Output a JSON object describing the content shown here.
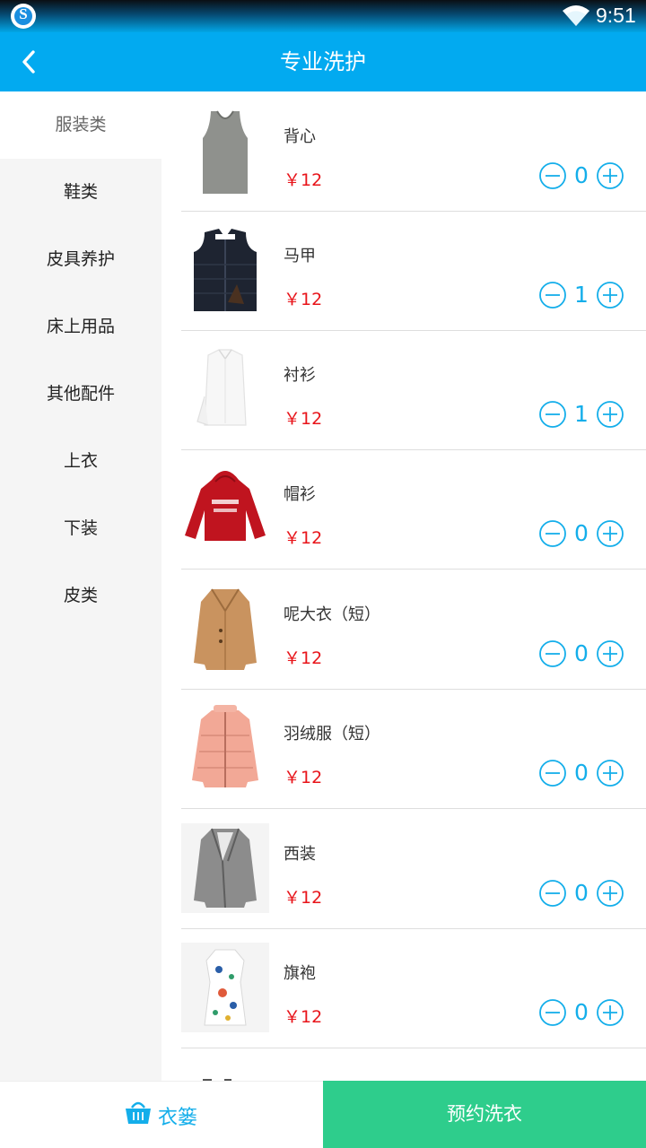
{
  "status_bar": {
    "time": "9:51",
    "app_icon": "sogou-s-icon",
    "wifi_icon": "wifi-icon"
  },
  "header": {
    "title": "专业洗护",
    "back_icon": "chevron-left-icon"
  },
  "categories": [
    {
      "label": "服装类",
      "active": true
    },
    {
      "label": "鞋类"
    },
    {
      "label": "皮具养护"
    },
    {
      "label": "床上用品"
    },
    {
      "label": "其他配件"
    },
    {
      "label": "上衣"
    },
    {
      "label": "下装"
    },
    {
      "label": "皮类"
    }
  ],
  "products": [
    {
      "name": "背心",
      "price": "￥12",
      "qty": "0",
      "image": "tank-top"
    },
    {
      "name": "马甲",
      "price": "￥12",
      "qty": "1",
      "image": "vest"
    },
    {
      "name": "衬衫",
      "price": "￥12",
      "qty": "1",
      "image": "shirt"
    },
    {
      "name": "帽衫",
      "price": "￥12",
      "qty": "0",
      "image": "hoodie"
    },
    {
      "name": "呢大衣（短）",
      "price": "￥12",
      "qty": "0",
      "image": "wool-coat"
    },
    {
      "name": "羽绒服（短）",
      "price": "￥12",
      "qty": "0",
      "image": "down-jacket"
    },
    {
      "name": "西装",
      "price": "￥12",
      "qty": "0",
      "image": "suit-jacket"
    },
    {
      "name": "旗袍",
      "price": "￥12",
      "qty": "0",
      "image": "qipao"
    }
  ],
  "footer": {
    "basket_label": "衣篓",
    "basket_icon": "basket-icon",
    "book_label": "预约洗衣"
  },
  "colors": {
    "primary": "#02aaf0",
    "accent_green": "#2ecd8c",
    "price_red": "#e8141a",
    "qty_blue": "#14aeea"
  }
}
